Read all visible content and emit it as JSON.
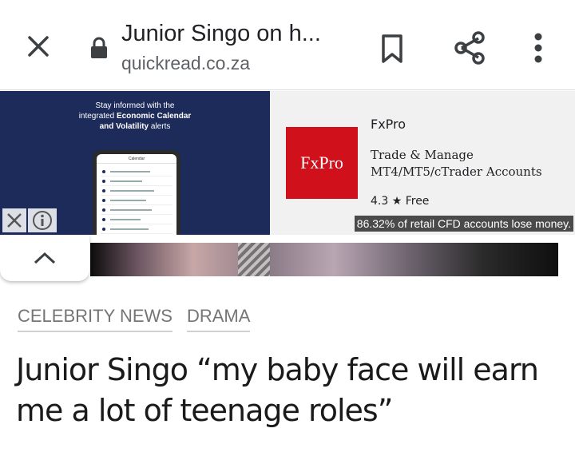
{
  "browser": {
    "page_title": "Junior Singo on h...",
    "url": "quickread.co.za",
    "icons": {
      "close": "close-icon",
      "lock": "lock-icon",
      "bookmark": "bookmark-icon",
      "share": "share-icon",
      "menu": "more-vert-icon"
    }
  },
  "ad": {
    "tagline_line1": "Stay informed with the",
    "tagline_line2_prefix": "integrated ",
    "tagline_line2_bold": "Economic Calendar",
    "tagline_line3_bold": "and Volatility",
    "tagline_line3_suffix": " alerts",
    "phone_header": "Calendar",
    "logo_text": "FxPro",
    "advertiser": "FxPro",
    "description": "Trade & Manage MT4/MT5/cTrader Accounts",
    "rating": "4.3 ★ Free",
    "warning": "86.32% of retail CFD accounts lose money.",
    "brand_color": "#d0111b",
    "panel_color": "#1c2b5a"
  },
  "article": {
    "categories": [
      "CELEBRITY NEWS",
      "DRAMA"
    ],
    "headline": "Junior Singo “my baby face will earn me a lot of teenage roles”"
  }
}
